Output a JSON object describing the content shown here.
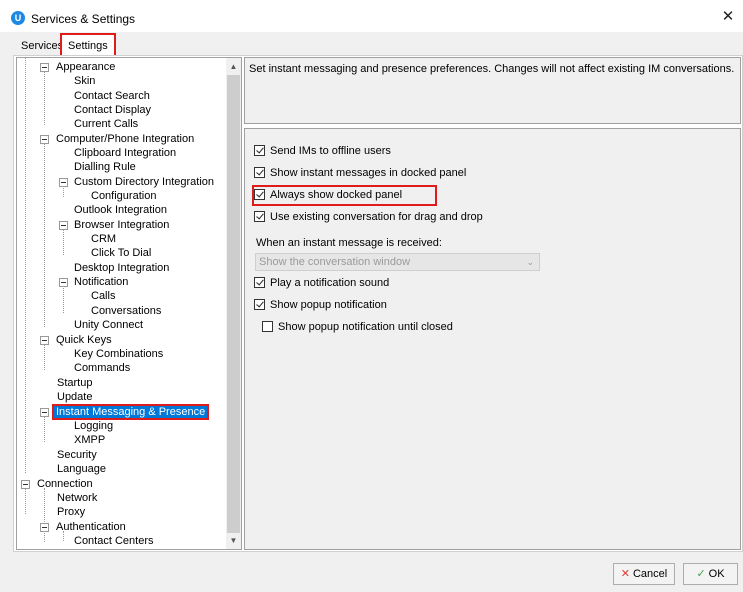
{
  "window": {
    "title": "Services & Settings",
    "app_icon_text": "U",
    "close_glyph": "✕"
  },
  "tabs": [
    {
      "label": "Services"
    },
    {
      "label": "Settings",
      "active": true
    }
  ],
  "tree": {
    "items": [
      {
        "label": "Appearance"
      },
      {
        "label": "Skin"
      },
      {
        "label": "Contact Search"
      },
      {
        "label": "Contact Display"
      },
      {
        "label": "Current Calls"
      },
      {
        "label": "Computer/Phone Integration"
      },
      {
        "label": "Clipboard Integration"
      },
      {
        "label": "Dialling Rule"
      },
      {
        "label": "Custom Directory Integration"
      },
      {
        "label": "Configuration"
      },
      {
        "label": "Outlook Integration"
      },
      {
        "label": "Browser Integration"
      },
      {
        "label": "CRM"
      },
      {
        "label": "Click To Dial"
      },
      {
        "label": "Desktop Integration"
      },
      {
        "label": "Notification"
      },
      {
        "label": "Calls"
      },
      {
        "label": "Conversations"
      },
      {
        "label": "Unity Connect"
      },
      {
        "label": "Quick Keys"
      },
      {
        "label": "Key Combinations"
      },
      {
        "label": "Commands"
      },
      {
        "label": "Startup"
      },
      {
        "label": "Update"
      },
      {
        "label": "Instant Messaging & Presence",
        "selected": true
      },
      {
        "label": "Logging"
      },
      {
        "label": "XMPP"
      },
      {
        "label": "Security"
      },
      {
        "label": "Language"
      },
      {
        "label": "Connection"
      },
      {
        "label": "Network"
      },
      {
        "label": "Proxy"
      },
      {
        "label": "Authentication"
      },
      {
        "label": "Contact Centers"
      }
    ],
    "scroll_up_glyph": "▲",
    "scroll_down_glyph": "▼"
  },
  "description": "Set instant messaging and presence preferences.  Changes will not affect existing IM conversations.",
  "options": {
    "send_offline": {
      "label": "Send IMs to offline users",
      "checked": true
    },
    "show_docked": {
      "label": "Show instant messages in docked panel",
      "checked": true
    },
    "always_docked": {
      "label": "Always show docked panel",
      "checked": true
    },
    "existing_conv": {
      "label": "Use existing conversation for drag and drop",
      "checked": true
    },
    "received_label": "When an instant message is received:",
    "received_select": "Show the conversation window",
    "select_chevron": "⌄",
    "play_sound": {
      "label": "Play a notification sound",
      "checked": true
    },
    "popup": {
      "label": "Show popup notification",
      "checked": true
    },
    "popup_until_closed": {
      "label": "Show popup notification until closed",
      "checked": false
    }
  },
  "buttons": {
    "cancel": {
      "label": "Cancel",
      "glyph": "✕"
    },
    "ok": {
      "label": "OK",
      "glyph": "✓"
    }
  },
  "colors": {
    "accent_selection": "#0078d7",
    "highlight_red": "#e01b1b"
  }
}
